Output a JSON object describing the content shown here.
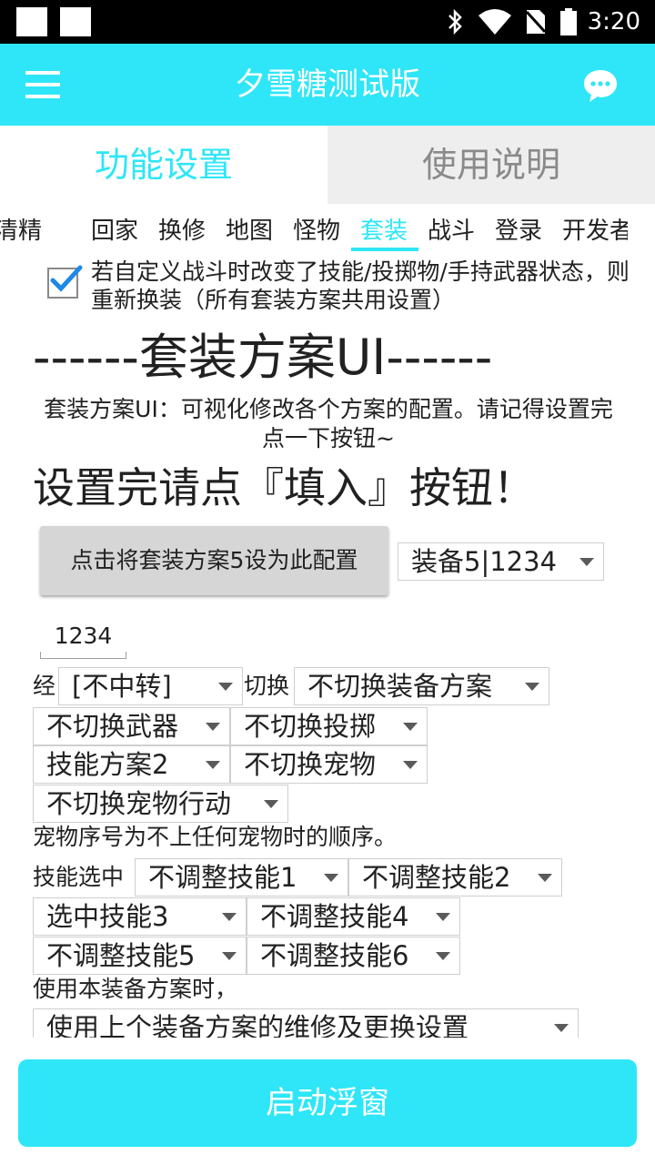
{
  "status_bar": {
    "time": "3:20",
    "icons": [
      "bluetooth-icon",
      "wifi-icon",
      "no-sim-icon",
      "battery-icon"
    ]
  },
  "app_bar": {
    "title": "夕雪糖测试版"
  },
  "tabs": [
    {
      "label": "功能设置"
    },
    {
      "label": "使用说明"
    }
  ],
  "sub_tabs": [
    "清精",
    "回家",
    "换修",
    "地图",
    "怪物",
    "套装",
    "战斗",
    "登录",
    "开发者"
  ],
  "checkbox_text": "若自定义战斗时改变了技能/投掷物/手持武器状态，则重新换装（所有套装方案共用设置）",
  "heading": "------套装方案UI------",
  "description": "套装方案UI：可视化修改各个方案的配置。请记得设置完点一下按钮~",
  "heading2": "设置完请点『填入』按钮！",
  "apply_button": "点击将套装方案5设为此配置",
  "scheme_select": "装备5|1234",
  "scheme_name": "1234",
  "labels": {
    "exp": "经",
    "switch": "切换",
    "pet_note": "宠物序号为不上任何宠物时的顺序。",
    "skill_select": "技能选中",
    "when_use": "使用本装备方案时，"
  },
  "selects": {
    "transfer": "[不中转]",
    "equip_plan": "不切换装备方案",
    "weapon": "不切换武器",
    "throw": "不切换投掷",
    "skill_plan": "技能方案2",
    "pet": "不切换宠物",
    "pet_action": "不切换宠物行动",
    "skill1": "不调整技能1",
    "skill2": "不调整技能2",
    "skill3": "选中技能3",
    "skill4": "不调整技能4",
    "skill5": "不调整技能5",
    "skill6": "不调整技能6",
    "repair": "使用上个装备方案的维修及更换设置"
  },
  "start_button": "启动浮窗",
  "colors": {
    "accent": "#2ee6f7",
    "tab_inactive_bg": "#eeeeee",
    "checkbox_blue": "#1e88e5"
  }
}
